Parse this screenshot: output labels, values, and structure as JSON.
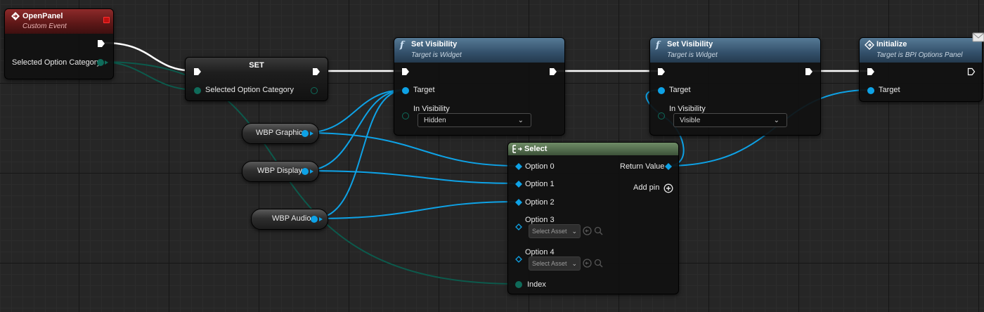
{
  "nodes": {
    "open_panel": {
      "title": "OpenPanel",
      "subtitle": "Custom Event",
      "output_label": "Selected Option Category"
    },
    "set_node": {
      "title": "SET",
      "input_label": "Selected Option Category"
    },
    "set_visibility_1": {
      "title": "Set Visibility",
      "subtitle": "Target is Widget",
      "target_label": "Target",
      "in_visibility_label": "In Visibility",
      "in_visibility_value": "Hidden"
    },
    "set_visibility_2": {
      "title": "Set Visibility",
      "subtitle": "Target is Widget",
      "target_label": "Target",
      "in_visibility_label": "In Visibility",
      "in_visibility_value": "Visible"
    },
    "initialize": {
      "title": "Initialize",
      "subtitle": "Target is BPI Options Panel",
      "target_label": "Target"
    },
    "select": {
      "title": "Select",
      "options": [
        "Option 0",
        "Option 1",
        "Option 2",
        "Option 3",
        "Option 4"
      ],
      "asset_placeholder": "Select Asset",
      "return_label": "Return Value",
      "add_pin_label": "Add pin",
      "index_label": "Index"
    },
    "variables": {
      "graphic": "WBP Graphic",
      "display": "WBP Display",
      "audio": "WBP Audio"
    }
  },
  "colors": {
    "exec_wire": "#ffffff",
    "object_wire": "#0ea2e6",
    "enum_wire": "#0c5a4c",
    "enum_pin": "#0f6b5a",
    "event_header": "#8d2a2a",
    "function_header": "#33506a",
    "select_header": "#4c6447"
  },
  "icons": {
    "event": "diamond-arrow-icon",
    "function": "function-f-icon",
    "select": "select-branch-icon",
    "add_pin": "plus-circle-icon",
    "browse": "arrow-left-circle-icon",
    "search": "search-icon",
    "message": "envelope-icon"
  }
}
